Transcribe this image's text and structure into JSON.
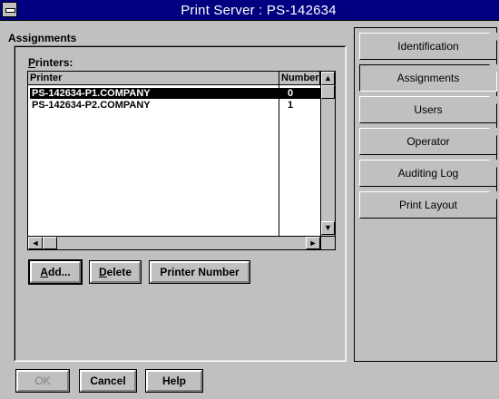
{
  "window": {
    "title": "Print Server : PS-142634",
    "system_menu_icon": "system-menu-bar"
  },
  "section": {
    "title": "Assignments"
  },
  "printers": {
    "label_prefix": "P",
    "label_rest": "rinters:",
    "columns": [
      "Printer",
      "Number"
    ],
    "rows": [
      {
        "name": "PS-142634-P1.COMPANY",
        "number": "0",
        "selected": true
      },
      {
        "name": "PS-142634-P2.COMPANY",
        "number": "1",
        "selected": false
      }
    ],
    "scroll_up_icon": "▲",
    "scroll_down_icon": "▼",
    "scroll_left_icon": "◄",
    "scroll_right_icon": "►"
  },
  "actions": {
    "add": {
      "mnemonic": "A",
      "rest": "dd..."
    },
    "delete": {
      "mnemonic": "D",
      "rest": "elete"
    },
    "printer_number": {
      "label": "Printer Number"
    }
  },
  "tabs": [
    {
      "label": "Identification",
      "active": false
    },
    {
      "label": "Assignments",
      "active": true
    },
    {
      "label": "Users",
      "active": false
    },
    {
      "label": "Operator",
      "active": false
    },
    {
      "label": "Auditing Log",
      "active": false
    },
    {
      "label": "Print Layout",
      "active": false
    }
  ],
  "footer": {
    "ok": "OK",
    "cancel": "Cancel",
    "help": "Help"
  },
  "colors": {
    "titlebar": "#000080",
    "face": "#c0c0c0",
    "selection": "#000000"
  }
}
